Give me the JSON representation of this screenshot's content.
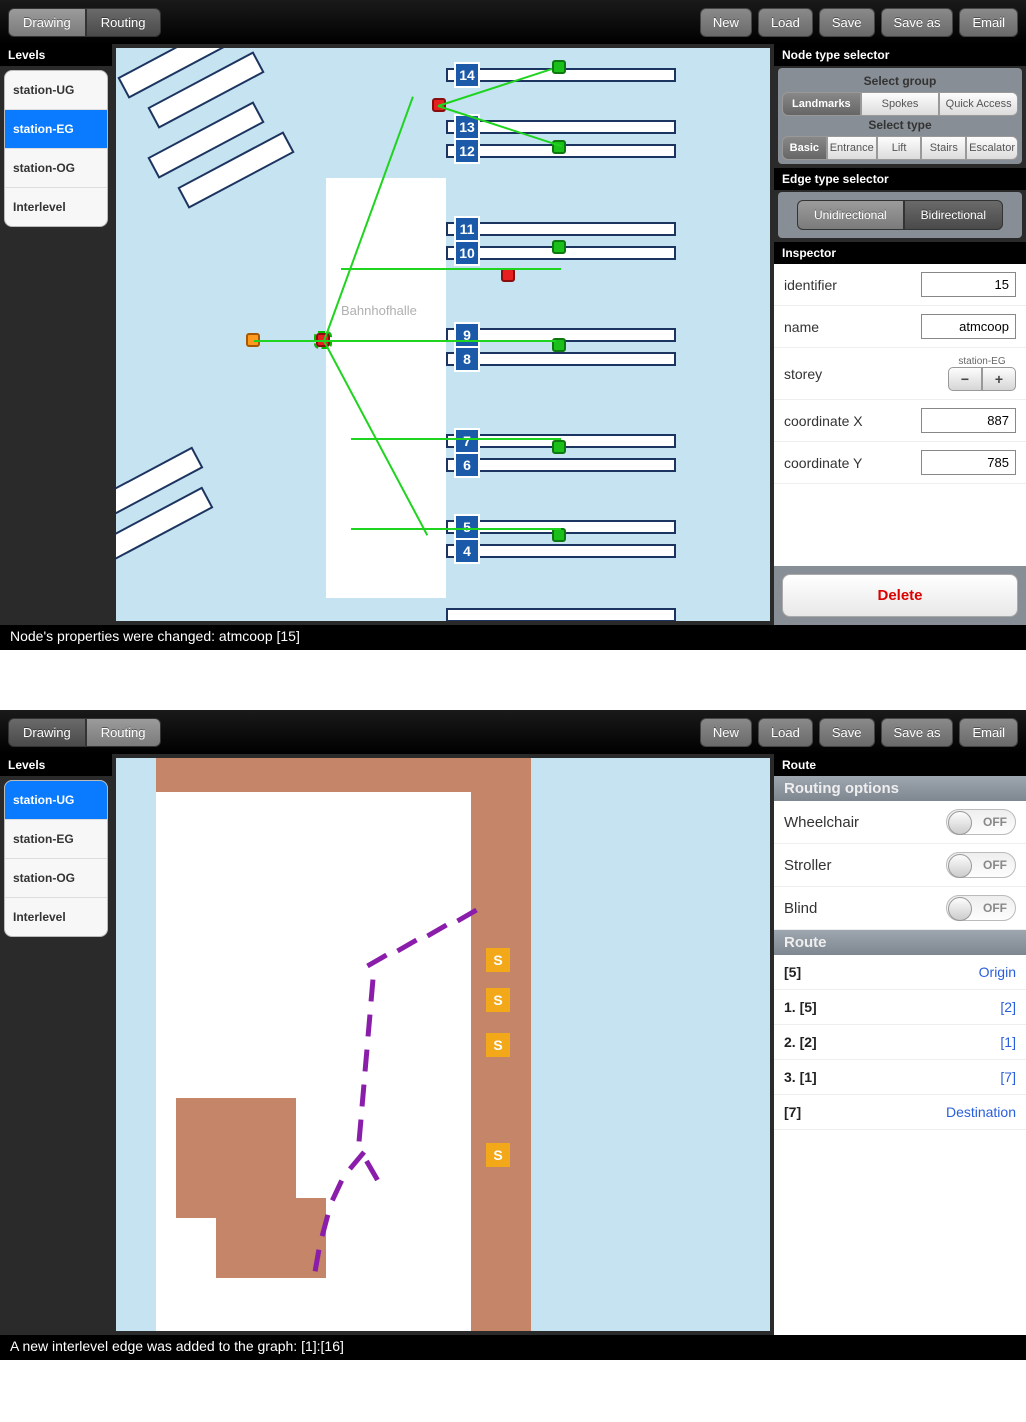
{
  "top": {
    "mode_tabs": [
      "Drawing",
      "Routing"
    ],
    "mode_active": 0,
    "actions": [
      "New",
      "Load",
      "Save",
      "Save as",
      "Email"
    ],
    "levels_header": "Levels",
    "levels": [
      "station-UG",
      "station-EG",
      "station-OG",
      "Interlevel"
    ],
    "level_active": 1,
    "node_selector_header": "Node type selector",
    "group_label": "Select group",
    "groups": [
      "Landmarks",
      "Spokes",
      "Quick Access"
    ],
    "group_active": 0,
    "type_label": "Select type",
    "types": [
      "Basic",
      "Entrance",
      "Lift",
      "Stairs",
      "Escalator"
    ],
    "type_active": 0,
    "edge_selector_header": "Edge type selector",
    "edge_types": [
      "Unidirectional",
      "Bidirectional"
    ],
    "edge_active": 0,
    "inspector_header": "Inspector",
    "inspector": {
      "identifier_label": "identifier",
      "identifier_value": "15",
      "name_label": "name",
      "name_value": "atmcoop",
      "storey_label": "storey",
      "storey_value": "station-EG",
      "coordx_label": "coordinate X",
      "coordx_value": "887",
      "coordy_label": "coordinate Y",
      "coordy_value": "785",
      "delete_label": "Delete"
    },
    "map_label": "Bahnhofhalle",
    "platform_numbers": [
      "14",
      "13",
      "12",
      "11",
      "10",
      "9",
      "8",
      "7",
      "6",
      "5",
      "4"
    ],
    "status": "Node's properties were changed: atmcoop [15]"
  },
  "bottom": {
    "mode_tabs": [
      "Drawing",
      "Routing"
    ],
    "mode_active": 1,
    "actions": [
      "New",
      "Load",
      "Save",
      "Save as",
      "Email"
    ],
    "levels_header": "Levels",
    "levels": [
      "station-UG",
      "station-EG",
      "station-OG",
      "Interlevel"
    ],
    "level_active": 0,
    "route_header": "Route",
    "routing_options_header": "Routing options",
    "options": [
      {
        "label": "Wheelchair",
        "state": "OFF"
      },
      {
        "label": "Stroller",
        "state": "OFF"
      },
      {
        "label": "Blind",
        "state": "OFF"
      }
    ],
    "route_section_header": "Route",
    "route_items": [
      {
        "left": "[5]",
        "right": "Origin"
      },
      {
        "left": "1. [5]",
        "right": "[2]"
      },
      {
        "left": "2. [2]",
        "right": "[1]"
      },
      {
        "left": "3. [1]",
        "right": "[7]"
      },
      {
        "left": "[7]",
        "right": "Destination"
      }
    ],
    "s_marker": "S",
    "status": "A new interlevel edge was added to the graph: [1]:[16]"
  }
}
